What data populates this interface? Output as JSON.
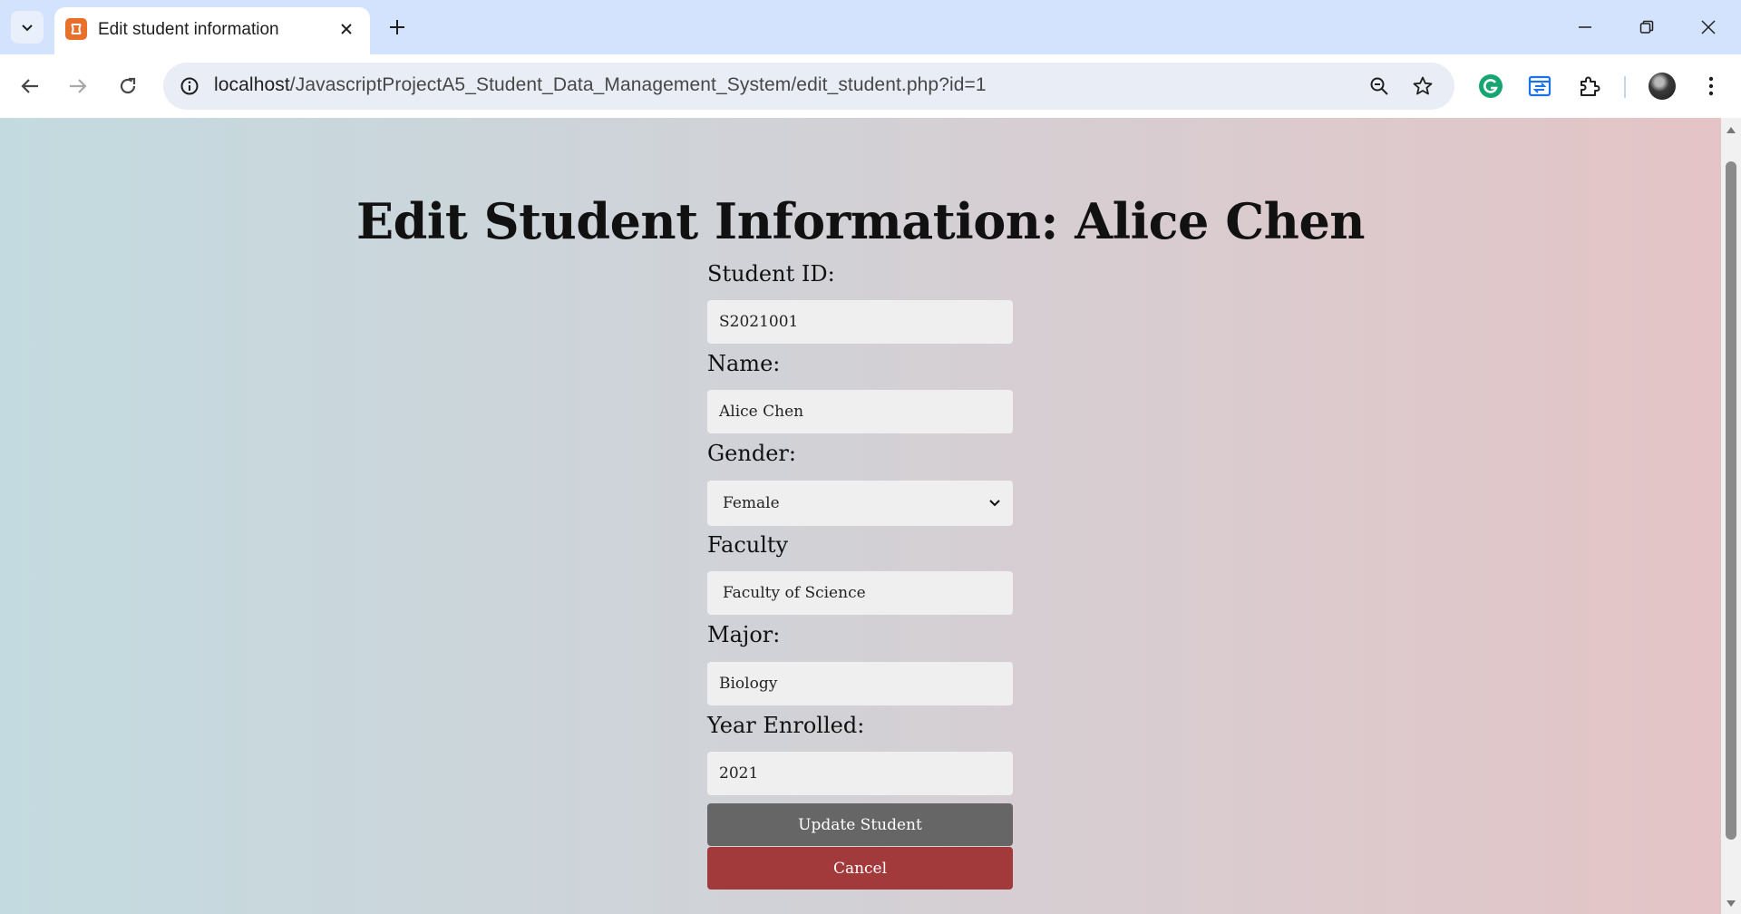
{
  "browser": {
    "tab_title": "Edit student information",
    "url_host": "localhost",
    "url_path": "/JavascriptProjectA5_Student_Data_Management_System/edit_student.php?id=1",
    "favicon_color": "#e8702a"
  },
  "page": {
    "title": "Edit Student Information: Alice Chen",
    "fields": {
      "student_id": {
        "label": "Student ID:",
        "value": "S2021001"
      },
      "name": {
        "label": "Name:",
        "value": "Alice Chen"
      },
      "gender": {
        "label": "Gender:",
        "value": "Female"
      },
      "faculty": {
        "label": "Faculty",
        "value": "Faculty of Science"
      },
      "major": {
        "label": "Major:",
        "value": "Biology"
      },
      "year_enrolled": {
        "label": "Year Enrolled:",
        "value": "2021"
      }
    },
    "buttons": {
      "update": "Update Student",
      "cancel": "Cancel"
    },
    "colors": {
      "update_button": "#666666",
      "cancel_button": "#a23a3c",
      "background_left": "#c3dbe0",
      "background_right": "#e4c4c6"
    }
  }
}
